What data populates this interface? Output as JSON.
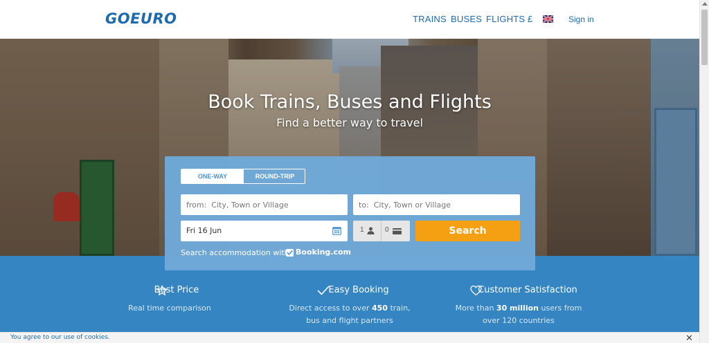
{
  "header": {
    "logo": "GOEURO",
    "nav": {
      "trains": "TRAINS",
      "buses": "BUSES",
      "flights": "FLIGHTS",
      "currency": "£",
      "sign_in": "Sign in"
    },
    "language_flag_icon": "uk-flag-icon"
  },
  "hero": {
    "title": "Book Trains, Buses and Flights",
    "subtitle": "Find a better way to travel"
  },
  "search": {
    "trip_types": [
      "ONE-WAY",
      "ROUND-TRIP"
    ],
    "selected_trip_type": "ONE-WAY",
    "from_placeholder": "from:  City, Town or Village",
    "to_placeholder": "to:  City, Town or Village",
    "date_value": "Fri 16 Jun",
    "passengers_adults": "1",
    "passengers_cards": "0",
    "search_label": "Search",
    "accommodation_text": "Search accommodation with",
    "accommodation_checked": true,
    "accommodation_partner": "Booking.com"
  },
  "features": [
    {
      "icon": "star-icon",
      "title": "Best Price",
      "desc": "Real time comparison"
    },
    {
      "icon": "checkmark-icon",
      "title": "Easy Booking",
      "desc_before": "Direct access to over ",
      "desc_bold": "450",
      "desc_after": " train, bus and flight partners"
    },
    {
      "icon": "heart-icon",
      "title": "Customer Satisfaction",
      "desc_before": "More than ",
      "desc_bold": "30 million",
      "desc_after": " users from over 120 countries"
    }
  ],
  "cookie_bar": {
    "text": "You agree to our use of cookies.",
    "close": "✕"
  },
  "colors": {
    "brand_blue": "#1c6ab0",
    "panel_blue": "#6faada",
    "features_blue": "#3585c3",
    "search_orange": "#f4a012"
  }
}
